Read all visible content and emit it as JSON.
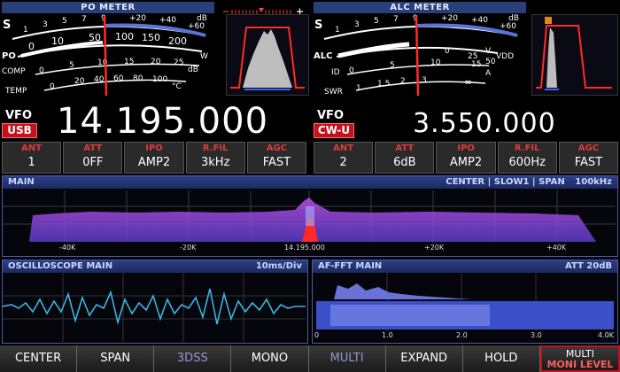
{
  "meters": {
    "po_title": "PO METER",
    "alc_title": "ALC METER",
    "po_meter": {
      "s_label": "S",
      "s_ticks": [
        "1",
        "3",
        "5",
        "7",
        "9",
        "+20",
        "+40",
        "+60"
      ],
      "s_unit": "dB",
      "po_label": "PO",
      "po_ticks": [
        "0",
        "10",
        "50",
        "100",
        "150",
        "200"
      ],
      "po_unit": "W",
      "comp_label": "COMP",
      "comp_ticks": [
        "0",
        "5",
        "10",
        "15",
        "20",
        "25"
      ],
      "comp_unit": "dB",
      "temp_label": "TEMP",
      "temp_ticks": [
        "0",
        "20",
        "40",
        "60",
        "80",
        "100"
      ],
      "temp_unit": "°C"
    },
    "alc_meter": {
      "s_label": "S",
      "s_ticks": [
        "1",
        "3",
        "5",
        "7",
        "9",
        "+20",
        "+40",
        "+60"
      ],
      "s_unit": "dB",
      "alc_label": "ALC",
      "alc_ticks": [
        "0",
        "25",
        "50"
      ],
      "alc_unit": "V",
      "vdd_label": "VDD",
      "id_label": "ID",
      "id_ticks": [
        "0",
        "5",
        "10",
        "15"
      ],
      "id_unit": "A",
      "swr_label": "SWR",
      "swr_ticks": [
        "1",
        "1.5",
        "2",
        "3",
        "∞"
      ]
    }
  },
  "vfo_main": {
    "tag": "VFO",
    "mode": "USB",
    "frequency": "14.195.000",
    "settings": [
      {
        "label": "ANT",
        "value": "1"
      },
      {
        "label": "ATT",
        "value": "0FF"
      },
      {
        "label": "IPO",
        "value": "AMP2"
      },
      {
        "label": "R.FIL",
        "value": "3kHz"
      },
      {
        "label": "AGC",
        "value": "FAST"
      }
    ]
  },
  "vfo_sub": {
    "tag": "VFO",
    "mode": "CW-U",
    "frequency": "3.550.000",
    "settings": [
      {
        "label": "ANT",
        "value": "2"
      },
      {
        "label": "ATT",
        "value": "6dB"
      },
      {
        "label": "IPO",
        "value": "AMP2"
      },
      {
        "label": "R.FIL",
        "value": "600Hz"
      },
      {
        "label": "AGC",
        "value": "FAST"
      }
    ]
  },
  "spectrum": {
    "title": "MAIN",
    "status": "CENTER | SLOW1 | SPAN",
    "span": "100kHz",
    "axis_labels": [
      "-40K",
      "-20K",
      "14.195.000",
      "+20K",
      "+40K"
    ]
  },
  "oscilloscope": {
    "title": "OSCILLOSCOPE MAIN",
    "timebase": "10ms/Div"
  },
  "af_fft": {
    "title": "AF-FFT MAIN",
    "attenuation": "ATT 20dB",
    "axis_labels": [
      "0",
      "1.0",
      "2.0",
      "3.0",
      "4.0K"
    ]
  },
  "softkeys": [
    {
      "label": "CENTER"
    },
    {
      "label": "SPAN"
    },
    {
      "label": "3DSS"
    },
    {
      "label": "MONO"
    },
    {
      "label": "MULTI"
    },
    {
      "label": "EXPAND"
    },
    {
      "label": "HOLD"
    }
  ],
  "multi_key": {
    "label": "MULTI",
    "sub": "MONI LEVEL"
  },
  "colors": {
    "accent_red": "#c4121c",
    "panel_blue": "#2a3f7a",
    "scope_line": "#3ab4e0"
  }
}
